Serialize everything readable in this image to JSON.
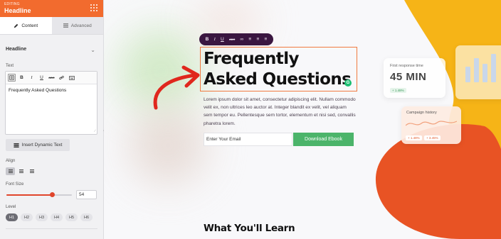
{
  "panel": {
    "header_sub": "EDITING",
    "header_title": "Headline",
    "tabs": {
      "content": "Content",
      "advanced": "Advanced"
    },
    "section_title": "Headline",
    "text_label": "Text",
    "toolbar": {
      "bold": "B",
      "italic": "I",
      "underline": "U",
      "strike": "ABC"
    },
    "text_value": "Frequently Asked Questions",
    "dynamic_button": "Insert Dynamic Text",
    "align_label": "Align",
    "font_size_label": "Font Size",
    "font_size_value": "54",
    "font_size_fraction": 0.7,
    "level_label": "Level",
    "levels": [
      "H1",
      "H2",
      "H3",
      "H4",
      "H5",
      "H6"
    ]
  },
  "canvas": {
    "heading": "Frequently Asked Questions",
    "body": "Lorem ipsum dolor sit amet, consectetur adipiscing elit. Nullam commodo velit ex, non ultrices leo auctor at. Integer blandit ex velit, vel aliquam sem tempor eu. Pellentesque sem tortor, elementum et nisi sed, convallis pharetra lorem.",
    "email_placeholder": "Enter Your Email",
    "download_button": "Download Ebook",
    "section2_title": "What You'll Learn",
    "card1": {
      "caption": "First response time",
      "value": "45 MIN",
      "badge": "+ 1.48%"
    },
    "card2": {
      "caption": "Campaign history",
      "badge1": "+ 1.48%",
      "badge2": "+ 3.45%"
    }
  },
  "colors": {
    "accent": "#f26b2e",
    "slider": "#e0452b",
    "cta": "#4cb46a",
    "toolbar_bg": "#3a1640"
  }
}
